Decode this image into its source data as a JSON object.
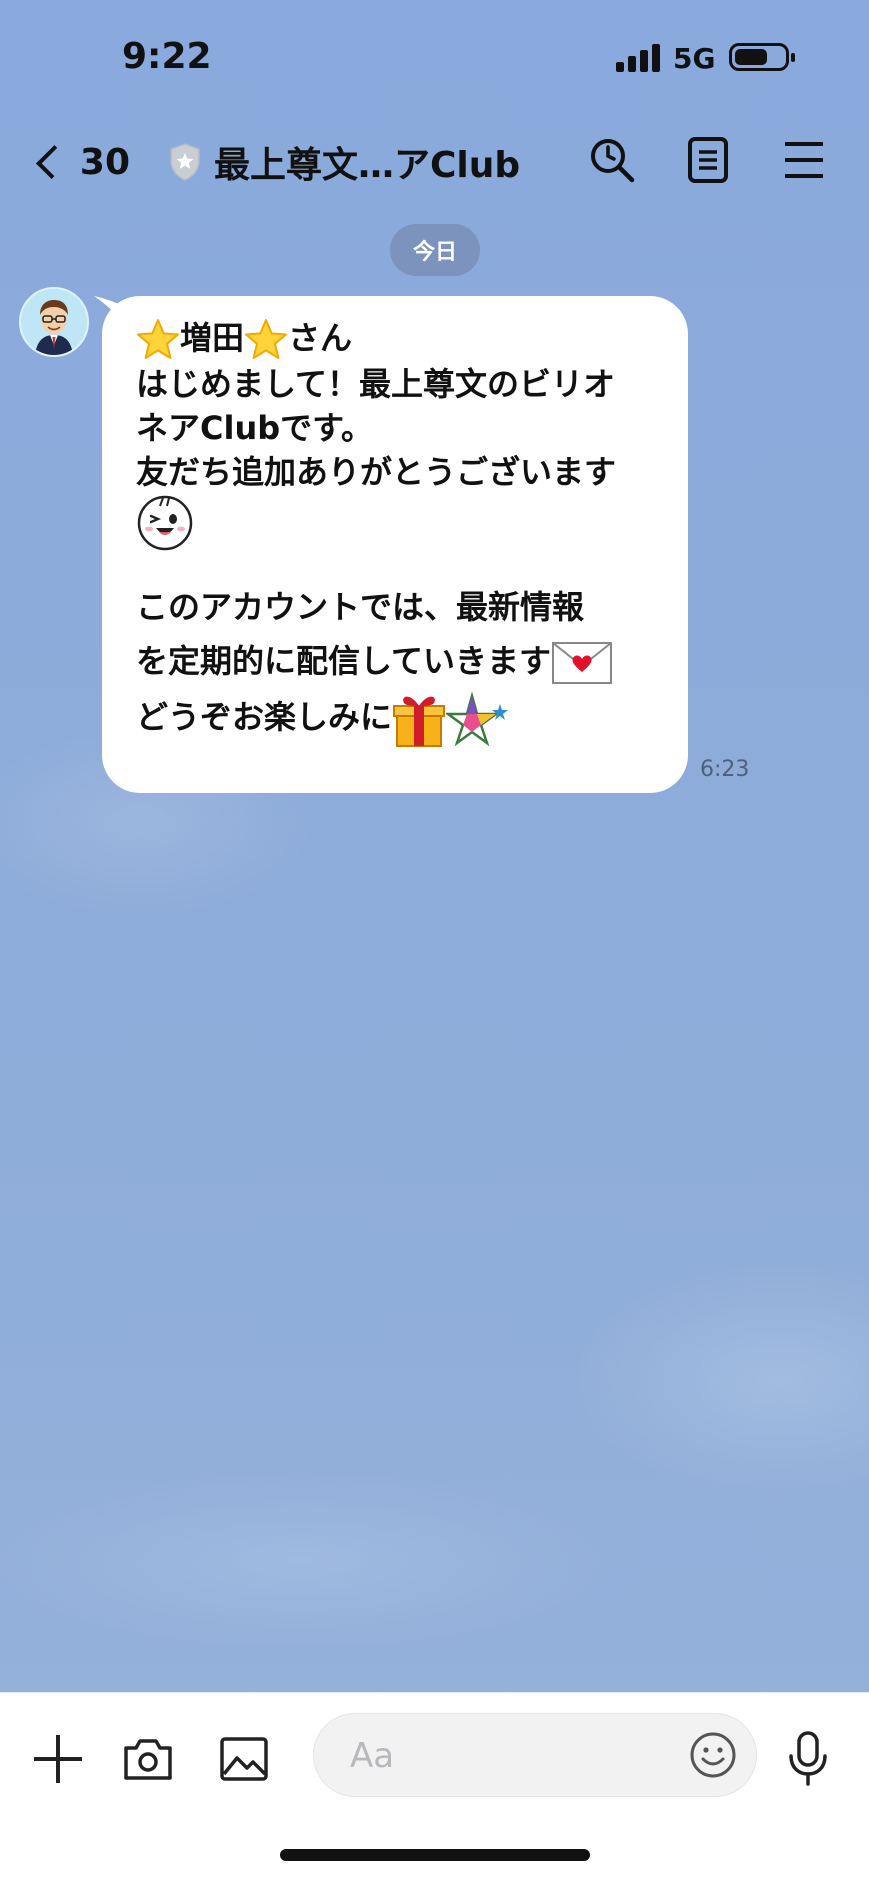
{
  "status_bar": {
    "time": "9:22",
    "network": "5G"
  },
  "header": {
    "back_count": "30",
    "title": "最上尊文…アClub",
    "icons": [
      "search-icon",
      "notes-icon",
      "menu-icon"
    ]
  },
  "chat": {
    "date_label": "今日",
    "message": {
      "line1_name": "増田",
      "line1_suffix": "さん",
      "line2": "はじめまして！最上尊文のビリオ",
      "line3": "ネアClubです。",
      "line4": "友だち追加ありがとうございます",
      "line6": "このアカウントでは、最新情報",
      "line7": "を定期的に配信していきます",
      "line8": "どうぞお楽しみに",
      "time": "6:23"
    }
  },
  "input_bar": {
    "placeholder": "Aa",
    "icons": [
      "plus-icon",
      "camera-icon",
      "image-icon",
      "emoji-icon",
      "mic-icon"
    ]
  },
  "colors": {
    "background": "#8eabd9",
    "bubble": "#ffffff",
    "date_chip": "#7c93bd"
  }
}
